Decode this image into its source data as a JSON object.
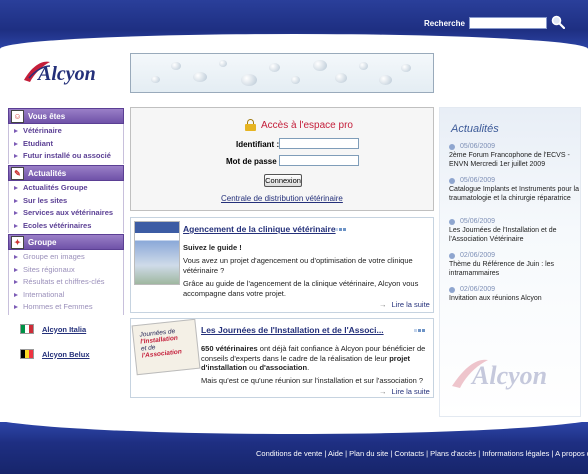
{
  "header": {
    "search_label": "Recherche",
    "search_value": ""
  },
  "brand": {
    "name": "Alcyon",
    "color_primary": "#24307a",
    "color_accent": "#c41e3a"
  },
  "sidebar": {
    "sections": [
      {
        "title": "Vous êtes",
        "items": [
          "Vétérinaire",
          "Etudiant",
          "Futur installé ou associé"
        ]
      },
      {
        "title": "Actualités",
        "items": [
          "Actualités Groupe",
          "Sur les sites",
          "Services aux vétérinaires",
          "Ecoles vétérinaires"
        ]
      },
      {
        "title": "Groupe",
        "items": [
          "Groupe en images",
          "Sites régionaux",
          "Résultats et chiffres-clés",
          "International",
          "Hommes et Femmes"
        ]
      }
    ],
    "countries": [
      {
        "label": "Alcyon Italia"
      },
      {
        "label": "Alcyon Belux"
      }
    ]
  },
  "login": {
    "title": "Accès à l'espace pro",
    "id_label": "Identifiant :",
    "pwd_label": "Mot de passe :",
    "submit": "Connexion",
    "central_link": "Centrale de distribution vétérinaire"
  },
  "articles": [
    {
      "title": "Agencement de la clinique vétérinaire",
      "lead": "Suivez le guide !",
      "p1": "Vous avez un projet d'agencement ou d'optimisation de votre clinique vétérinaire ?",
      "p2": "Grâce au guide de l'agencement de la clinique vétérinaire, Alcyon vous accompagne dans votre projet.",
      "more": "Lire la suite"
    },
    {
      "title": "Les Journées de l'Installation et de l'Associ...",
      "p1_bold": "650 vétérinaires",
      "p1": " ont déjà fait confiance à Alcyon pour bénéficier de conseils d'experts dans le cadre de la réalisation de leur ",
      "p1_bold2": "projet d'installation",
      "p1_mid": " ou ",
      "p1_bold3": "d'association",
      "p1_end": ".",
      "p2": "Mais qu'est ce qu'une réunion sur l'installation et sur l'association ?",
      "more": "Lire la suite",
      "thumb_line1": "Journées de",
      "thumb_line2": "l'Installation",
      "thumb_line3": "et de",
      "thumb_line4": "l'Association"
    }
  ],
  "news": {
    "title": "Actualités",
    "items": [
      {
        "date": "05/06/2009",
        "text": "2ème Forum Francophone de l'ECVS - ENVN Mercredi 1er juillet 2009"
      },
      {
        "date": "05/06/2009",
        "text": "Catalogue Implants et Instruments pour la traumatologie et la chirurgie réparatrice"
      },
      {
        "date": "05/06/2009",
        "text": "Les Journées de l'Installation et de l'Association Vétérinaire"
      },
      {
        "date": "02/06/2009",
        "text": "Thème du Référence de Juin : les intramammaires"
      },
      {
        "date": "02/06/2009",
        "text": "Invitation aux réunions Alcyon"
      }
    ]
  },
  "footer": {
    "links": "Conditions de vente | Aide | Plan du site | Contacts | Plans d'accès | Informations légales | A propos de"
  }
}
